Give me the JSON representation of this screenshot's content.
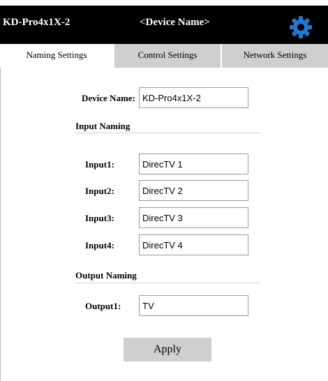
{
  "header": {
    "model": "KD-Pro4x1X-2",
    "device_name_title": "<Device Name>",
    "settings_icon": "gear-icon",
    "settings_icon_color": "#1e7ad1"
  },
  "tabs": [
    {
      "label": "Naming Settings",
      "active": true
    },
    {
      "label": "Control Settings",
      "active": false
    },
    {
      "label": "Network Settings",
      "active": false
    }
  ],
  "form": {
    "device_name_label": "Device Name:",
    "device_name_value": "KD-Pro4x1X-2",
    "input_section": "Input Naming",
    "inputs": [
      {
        "label": "Input1:",
        "value": "DirecTV 1"
      },
      {
        "label": "Input2:",
        "value": "DirecTV 2"
      },
      {
        "label": "Input3:",
        "value": "DirecTV 3"
      },
      {
        "label": "Input4:",
        "value": "DirecTV 4"
      }
    ],
    "output_section": "Output Naming",
    "outputs": [
      {
        "label": "Output1:",
        "value": "TV"
      }
    ],
    "apply_label": "Apply"
  }
}
